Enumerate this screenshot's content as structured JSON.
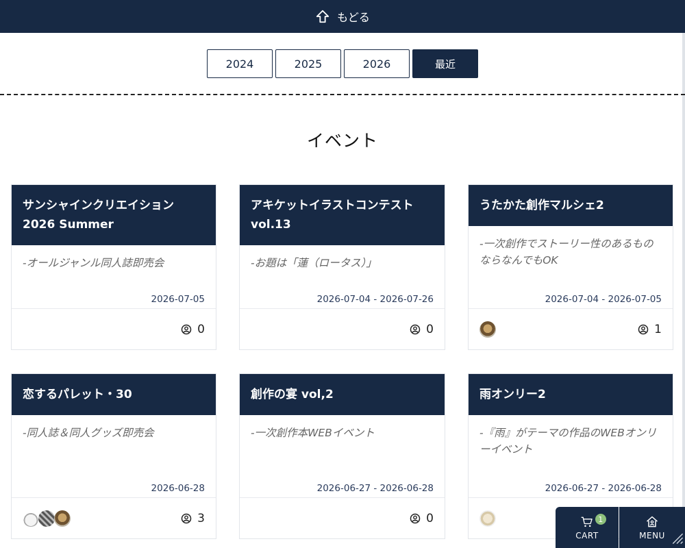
{
  "header": {
    "back_label": "もどる"
  },
  "years": [
    {
      "label": "2024",
      "active": false
    },
    {
      "label": "2025",
      "active": false
    },
    {
      "label": "2026",
      "active": false
    },
    {
      "label": "最近",
      "active": true
    }
  ],
  "page": {
    "title": "イベント"
  },
  "events": [
    {
      "title": "サンシャインクリエイション 2026 Summer",
      "desc": "-オールジャンル同人誌即売会",
      "date": "2026-07-05",
      "count": "0",
      "avatars": []
    },
    {
      "title": "アキケットイラストコンテスト vol.13",
      "desc": "-お題は「蓮（ロータス）」",
      "date": "2026-07-04 - 2026-07-26",
      "count": "0",
      "avatars": []
    },
    {
      "title": "うたかた創作マルシェ2",
      "desc": "-一次創作でストーリー性のあるものならなんでもOK",
      "date": "2026-07-04 - 2026-07-05",
      "count": "1",
      "avatars": [
        "#8a6a3c"
      ]
    },
    {
      "title": "恋するパレット・30",
      "desc": "-同人誌＆同人グッズ即売会",
      "date": "2026-06-28",
      "count": "3",
      "avatars": [
        "#d8d8d8",
        "#7a7a7a",
        "#9a7a4c"
      ]
    },
    {
      "title": "創作の宴 vol,2",
      "desc": "-一次創作本WEBイベント",
      "date": "2026-06-27 - 2026-06-28",
      "count": "0",
      "avatars": []
    },
    {
      "title": "雨オンリー2",
      "desc": "-『雨』がテーマの作品のWEBオンリーイベント",
      "date": "2026-06-27 - 2026-06-28",
      "count": "",
      "avatars": [
        "#e6dcc8"
      ]
    }
  ],
  "cart": {
    "label": "CART",
    "badge": "1"
  },
  "menu": {
    "label": "MENU"
  }
}
